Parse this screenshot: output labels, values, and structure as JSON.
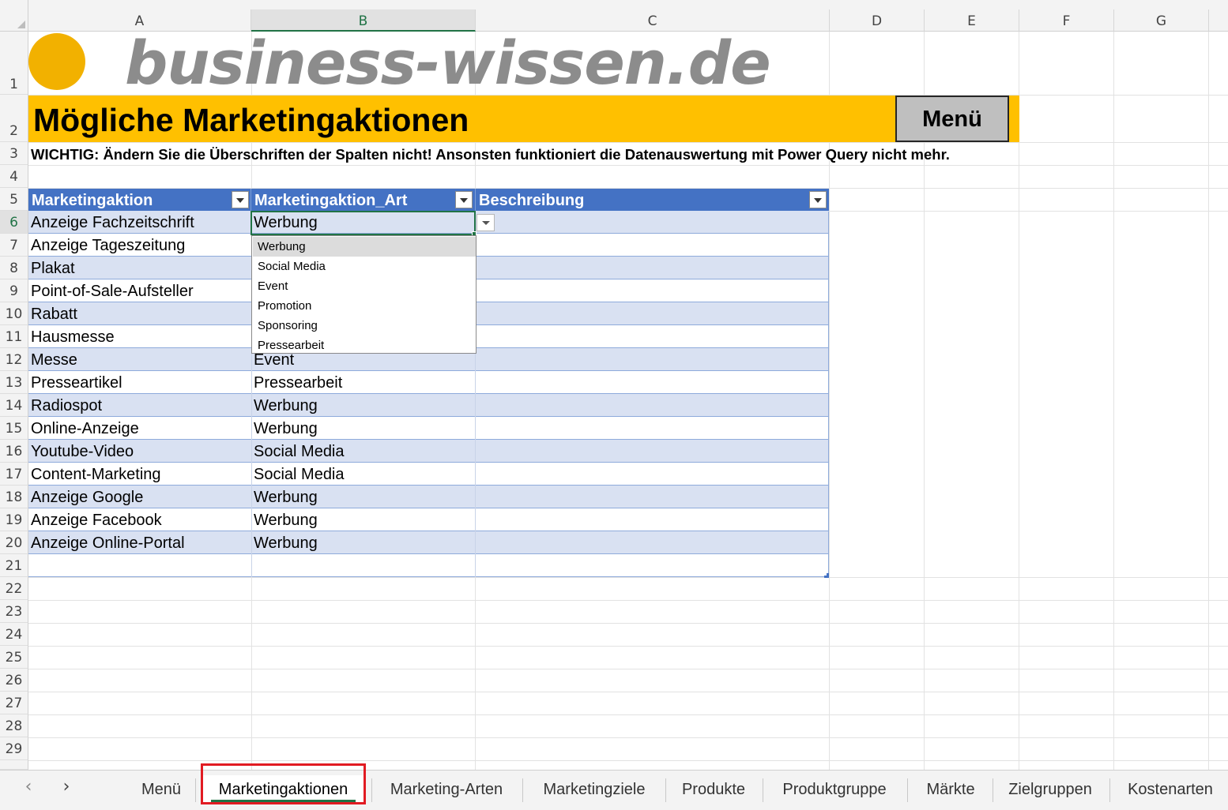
{
  "columns": [
    "A",
    "B",
    "C",
    "D",
    "E",
    "F",
    "G"
  ],
  "selected_column": "B",
  "rows": [
    "1",
    "2",
    "3",
    "4",
    "5",
    "6",
    "7",
    "8",
    "9",
    "10",
    "11",
    "12",
    "13",
    "14",
    "15",
    "16",
    "17",
    "18",
    "19",
    "20",
    "21",
    "22",
    "23",
    "24",
    "25",
    "26",
    "27",
    "28",
    "29"
  ],
  "selected_row": "6",
  "logo": {
    "text": "business-wissen.de",
    "dot_color": "#f2b100"
  },
  "title": "Mögliche Marketingaktionen",
  "menu_button": "Menü",
  "warning": "WICHTIG: Ändern Sie die Überschriften der Spalten nicht! Ansonsten funktioniert die Datenauswertung mit Power Query nicht mehr.",
  "table": {
    "headers": [
      "Marketingaktion",
      "Marketingaktion_Art",
      "Beschreibung"
    ],
    "rows": [
      [
        "Anzeige Fachzeitschrift",
        "Werbung"
      ],
      [
        "Anzeige Tageszeitung",
        ""
      ],
      [
        "Plakat",
        ""
      ],
      [
        "Point-of-Sale-Aufsteller",
        ""
      ],
      [
        "Rabatt",
        ""
      ],
      [
        "Hausmesse",
        ""
      ],
      [
        "Messe",
        "Event"
      ],
      [
        "Presseartikel",
        "Pressearbeit"
      ],
      [
        "Radiospot",
        "Werbung"
      ],
      [
        "Online-Anzeige",
        "Werbung"
      ],
      [
        "Youtube-Video",
        "Social Media"
      ],
      [
        "Content-Marketing",
        "Social Media"
      ],
      [
        "Anzeige Google",
        "Werbung"
      ],
      [
        "Anzeige Facebook",
        "Werbung"
      ],
      [
        "Anzeige Online-Portal",
        "Werbung"
      ]
    ]
  },
  "dropdown": {
    "options": [
      "Werbung",
      "Social Media",
      "Event",
      "Promotion",
      "Sponsoring",
      "Pressearbeit"
    ],
    "highlighted": "Werbung"
  },
  "sheet_tabs": [
    "Menü",
    "Marketingaktionen",
    "Marketing-Arten",
    "Marketingziele",
    "Produkte",
    "Produktgruppe",
    "Märkte",
    "Zielgruppen",
    "Kostenarten"
  ],
  "active_tab": "Marketingaktionen",
  "nav": {
    "prev": "‹",
    "next": "›"
  },
  "colors": {
    "accent": "#217346",
    "table_header": "#4472c4",
    "band": "#d9e1f2",
    "title_band": "#ffc000",
    "highlight_box": "#e11b22"
  }
}
